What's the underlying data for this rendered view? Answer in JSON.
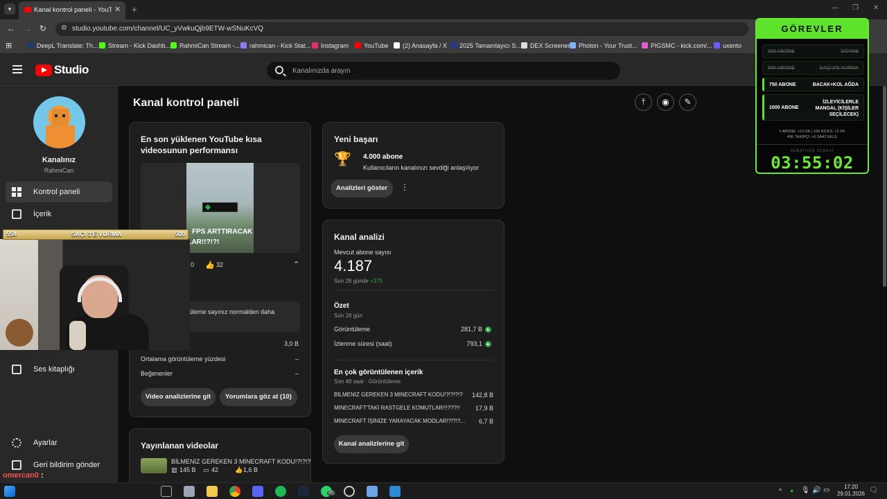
{
  "browser": {
    "tab_title": "Kanal kontrol paneli - YouTube",
    "url": "studio.youtube.com/channel/UC_yVwkuQjb9ETW-wSNuKcVQ",
    "bookmarks": [
      {
        "label": "DeepL Translate: Th...",
        "color": "#1b3f6b"
      },
      {
        "label": "Stream - Kick Dashb...",
        "color": "#53fc18"
      },
      {
        "label": "RahmiCan Stream -...",
        "color": "#53fc18"
      },
      {
        "label": "rahmican - Kick Stat...",
        "color": "#8a7cff"
      },
      {
        "label": "Instagram",
        "color": "#e1306c"
      },
      {
        "label": "YouTube",
        "color": "#ff0000"
      },
      {
        "label": "(2) Anasayfa / X",
        "color": "#ffffff"
      },
      {
        "label": "2025 Tamamlayıcı S...",
        "color": "#223c8c"
      },
      {
        "label": "DEX Screener",
        "color": "#dddddd"
      },
      {
        "label": "Photon - Your Trust...",
        "color": "#7fb2ff"
      },
      {
        "label": "PIGSMC - kick.com/...",
        "color": "#e05cc8"
      },
      {
        "label": "uxento",
        "color": "#6b5cff"
      }
    ]
  },
  "header": {
    "logo_text": "Studio",
    "search_placeholder": "Kanalınızda arayın"
  },
  "sidebar": {
    "channel_title": "Kanalınız",
    "channel_name": "RahmiCan",
    "items": [
      {
        "label": "Kontrol paneli",
        "icon": "dashboard-icon",
        "active": true
      },
      {
        "label": "İçerik",
        "icon": "content-icon",
        "active": false
      },
      {
        "label": "Ses kitaplığı",
        "icon": "audio-library-icon",
        "active": false
      },
      {
        "label": "Ayarlar",
        "icon": "settings-icon",
        "active": false
      },
      {
        "label": "Geri bildirim gönder",
        "icon": "feedback-icon",
        "active": false
      }
    ]
  },
  "main": {
    "page_title": "Kanal kontrol paneli",
    "latest_short": {
      "title": "En son yüklenen YouTube kısa videosunun performansı",
      "video_title_partial": "FPS ARTTIRACAK",
      "video_title_partial2": "MODLAR!!?!?!",
      "views_partial": "0",
      "likes": "32",
      "notice_partial": "üleme sayınız normalden daha",
      "rows": [
        {
          "label": "",
          "value": "3,0 B"
        },
        {
          "label": "Ortalama görüntüleme yüzdesi",
          "value": "–"
        },
        {
          "label": "Beğenenler",
          "value": "–"
        }
      ],
      "btn_video": "Video analizlerine git",
      "btn_comments": "Yorumlara göz at (10)"
    },
    "published": {
      "title": "Yayınlanan videolar",
      "video_title": "BİLMENİZ GEREKEN 3 MİNECRAFT KODU!?!?!?...",
      "views": "145 B",
      "comments": "42",
      "likes": "1,6 B"
    },
    "achievement": {
      "title": "Yeni başarı",
      "headline": "4.000 abone",
      "desc": "Kullanıcıların kanalınızı sevdiği anlaşılıyor",
      "btn": "Analizleri göster"
    },
    "analytics": {
      "title": "Kanal analizi",
      "subs_label": "Mevcut abone sayısı",
      "subs_value": "4.187",
      "subs_period": "Son 28 günde",
      "subs_change": "+375",
      "summary_title": "Özet",
      "summary_period": "Son 28 gün",
      "summary_rows": [
        {
          "label": "Görüntüleme",
          "value": "281,7 B"
        },
        {
          "label": "İzlenme süresi (saat)",
          "value": "793,1"
        }
      ],
      "top_title": "En çok görüntülenen içerik",
      "top_sub": "Son 48 saat · Görüntüleme",
      "top_rows": [
        {
          "label": "BİLMENİZ GEREKEN 3 MİNECRAFT KODU!?!?!?!?",
          "value": "142,8 B"
        },
        {
          "label": "MİNECRAFT'TAKİ RASTGELE KOMUTLAR!!!???!!",
          "value": "17,9 B"
        },
        {
          "label": "MİNECRAFT İŞİNİZE YARAYACAK MODLAR!?!?!?...",
          "value": "6,7 B"
        }
      ],
      "btn": "Kanal analizlerine git"
    }
  },
  "overlay": {
    "cam_bar_left": "554",
    "cam_bar_mid": "SAÇI 3'E VURMA",
    "cam_bar_right": "500",
    "gorevler_title": "GÖREVLER",
    "quests": [
      {
        "a": "300 ABONE",
        "b": "DÖVME",
        "state": "done"
      },
      {
        "a": "500 ABONE",
        "b": "SAÇI 3'E VURMA",
        "state": "done"
      },
      {
        "a": "750 ABONE",
        "b": "BACAK+KOL AĞDA",
        "state": "active"
      },
      {
        "a": "1000 ABONE",
        "b": "İZLEYİCİLERLE MANGAL (KİŞİLER SEÇİLECEK)",
        "state": "active"
      }
    ],
    "info_line1": "1 ABONE: +10 DK | 100 KICKS: +2 DK",
    "info_line2": "40K TAKİPÇİ: +6 SAAT EKLE",
    "subathon_label": "SUBATHON SÜRESİ",
    "timer": "03:55:02",
    "chat_user": "omercan0",
    "chat_sep": ":"
  },
  "taskbar": {
    "time": "17:20",
    "date": "29.01.2026",
    "badge": "85"
  }
}
